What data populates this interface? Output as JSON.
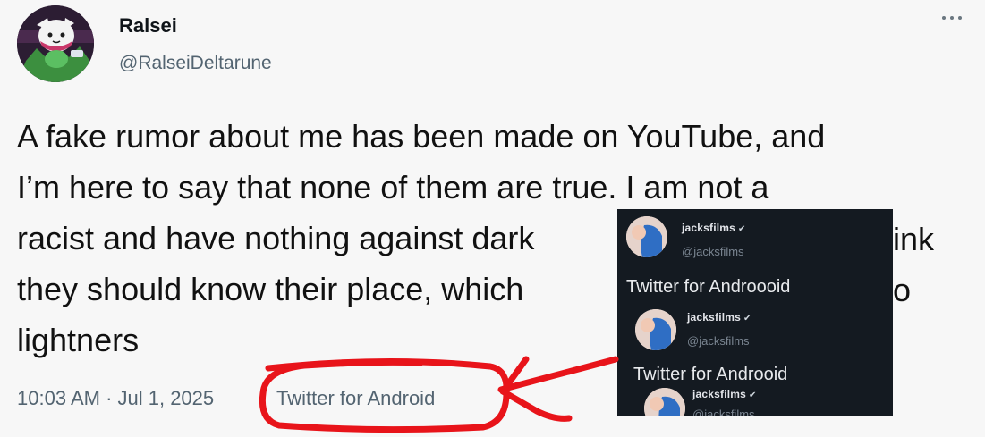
{
  "tweet": {
    "author_name": "Ralsei",
    "author_handle": "@RalseiDeltarune",
    "text_lines": [
      "A fake rumor about me has been made on YouTube, and",
      "I’m here to say that none of them are true. I am not a",
      "racist and have nothing against dark",
      "they should know their place, which",
      "lightners"
    ],
    "text_line3_tail": "ink",
    "text_line4_tail": "o",
    "timestamp": "10:03 AM · Jul 1, 2025",
    "source": "Twitter for Android"
  },
  "inset": {
    "rows": [
      {
        "name": "jacksfilms",
        "handle": "@jacksfilms",
        "source": "Twitter for Androooid"
      },
      {
        "name": "jacksfilms",
        "handle": "@jacksfilms",
        "source": "Twitter for Androoid"
      },
      {
        "name": "jacksfilms",
        "handle": "@jacksfilms",
        "source": ""
      }
    ]
  },
  "annotation": {
    "color": "#e8141a"
  },
  "colors": {
    "accent": "#1d9bf0",
    "muted": "#536471",
    "inset_bg": "#141a21"
  }
}
